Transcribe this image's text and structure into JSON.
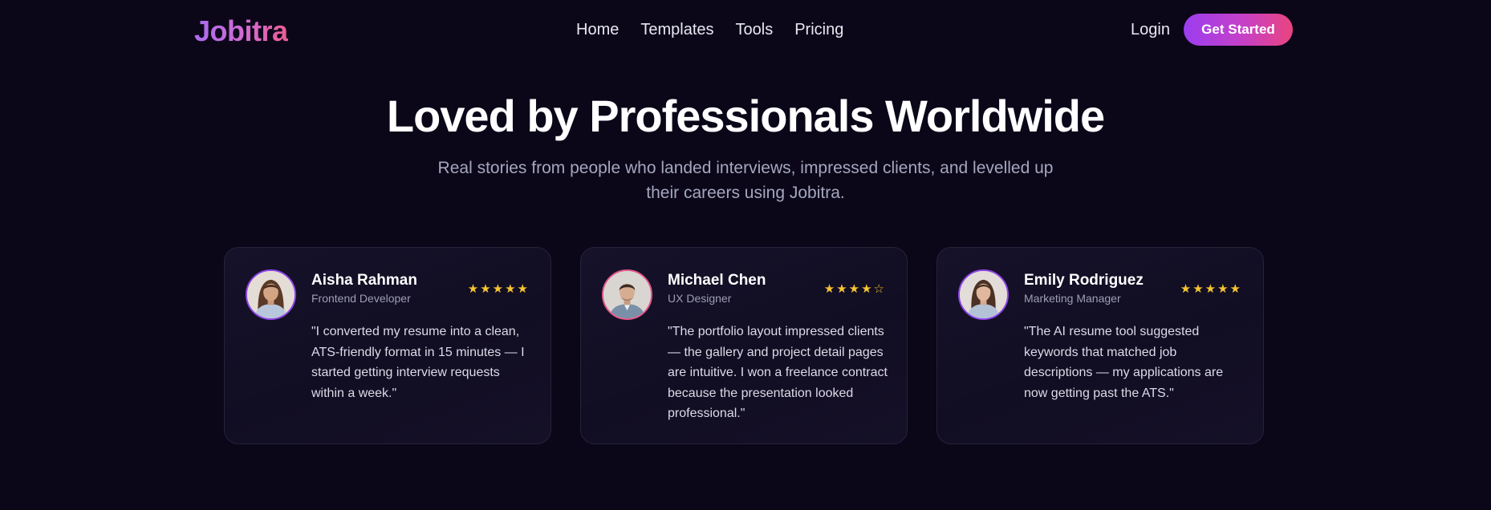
{
  "header": {
    "logo": "Jobitra",
    "nav": [
      "Home",
      "Templates",
      "Tools",
      "Pricing"
    ],
    "login": "Login",
    "cta": "Get Started"
  },
  "hero": {
    "title": "Loved by Professionals Worldwide",
    "subtitle": "Real stories from people who landed interviews, impressed clients, and levelled up their careers using Jobitra."
  },
  "testimonials": [
    {
      "name": "Aisha Rahman",
      "role": "Frontend Developer",
      "rating": 5,
      "stars": "★★★★★",
      "quote": "\"I converted my resume into a clean, ATS-friendly format in 15 minutes — I started getting interview requests within a week.\""
    },
    {
      "name": "Michael Chen",
      "role": "UX Designer",
      "rating": 4,
      "stars": "★★★★☆",
      "quote": "\"The portfolio layout impressed clients — the gallery and project detail pages are intuitive. I won a freelance contract because the presentation looked professional.\""
    },
    {
      "name": "Emily Rodriguez",
      "role": "Marketing Manager",
      "rating": 5,
      "stars": "★★★★★",
      "quote": "\"The AI resume tool suggested keywords that matched job descriptions — my applications are now getting past the ATS.\""
    }
  ],
  "colors": {
    "background": "#0b0719",
    "accent_purple": "#9b3ef0",
    "accent_pink": "#e9457e",
    "star": "#f6c531"
  }
}
